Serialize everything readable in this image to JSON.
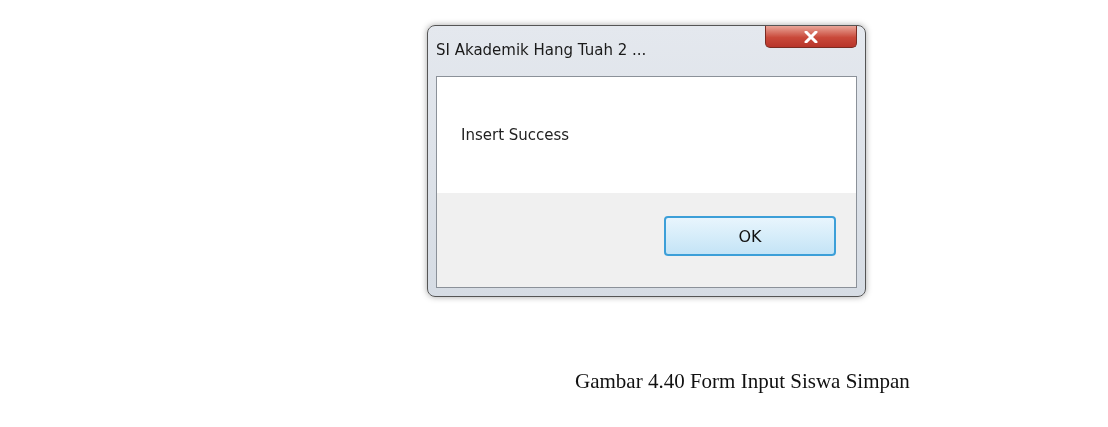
{
  "dialog": {
    "title": "SI Akademik Hang Tuah 2 ...",
    "message": "Insert Success",
    "buttons": [
      "OK"
    ]
  },
  "caption": "Gambar 4.40 Form Input Siswa Simpan"
}
